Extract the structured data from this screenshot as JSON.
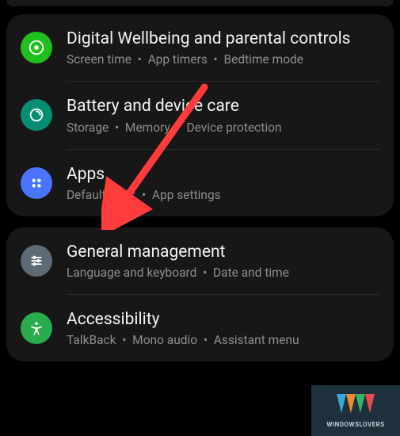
{
  "separator": "•",
  "group1": {
    "wellbeing": {
      "title": "Digital Wellbeing and parental controls",
      "sub1": "Screen time",
      "sub2": "App timers",
      "sub3": "Bedtime mode"
    },
    "battery": {
      "title": "Battery and device care",
      "sub1": "Storage",
      "sub2": "Memory",
      "sub3": "Device protection"
    },
    "apps": {
      "title": "Apps",
      "sub1": "Default apps",
      "sub2": "App settings"
    }
  },
  "group2": {
    "general": {
      "title": "General management",
      "sub1": "Language and keyboard",
      "sub2": "Date and time"
    },
    "accessibility": {
      "title": "Accessibility",
      "sub1": "TalkBack",
      "sub2": "Mono audio",
      "sub3": "Assistant menu"
    }
  },
  "watermark": {
    "text": "WINDOWSLOVERS"
  },
  "annotation_arrow_color": "#ff3b3b"
}
